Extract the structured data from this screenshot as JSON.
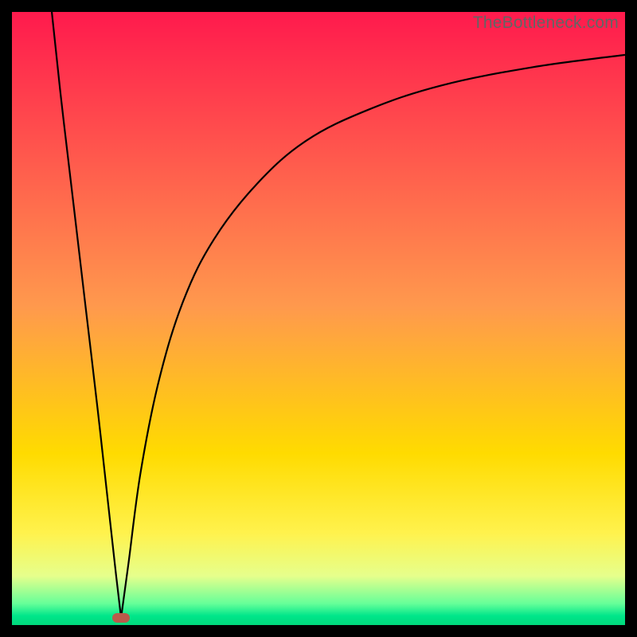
{
  "watermark": "TheBottleneck.com",
  "chart_data": {
    "type": "line",
    "title": "",
    "xlabel": "",
    "ylabel": "",
    "xlim": [
      0,
      100
    ],
    "ylim": [
      0,
      100
    ],
    "grid": false,
    "gradient_stops": [
      {
        "offset": 0,
        "color": "#ff1a4d"
      },
      {
        "offset": 0.48,
        "color": "#ff994d"
      },
      {
        "offset": 0.72,
        "color": "#ffdb00"
      },
      {
        "offset": 0.85,
        "color": "#fff24d"
      },
      {
        "offset": 0.92,
        "color": "#e6ff8c"
      },
      {
        "offset": 0.965,
        "color": "#66ff99"
      },
      {
        "offset": 0.985,
        "color": "#00e68a"
      },
      {
        "offset": 1,
        "color": "#00d97c"
      }
    ],
    "series": [
      {
        "name": "left-branch",
        "x": [
          6.5,
          8,
          10,
          12,
          14,
          16,
          17,
          17.8
        ],
        "values": [
          100,
          86,
          69,
          52,
          35,
          17,
          8,
          1.2
        ]
      },
      {
        "name": "right-branch",
        "x": [
          17.8,
          19,
          21,
          24,
          28,
          33,
          40,
          48,
          58,
          70,
          85,
          100
        ],
        "values": [
          1.2,
          10,
          25,
          40,
          53,
          63,
          72,
          79,
          84,
          88,
          91,
          93
        ]
      }
    ],
    "marker": {
      "x": 17.8,
      "y": 1.2,
      "color": "#ba5a4a"
    }
  }
}
